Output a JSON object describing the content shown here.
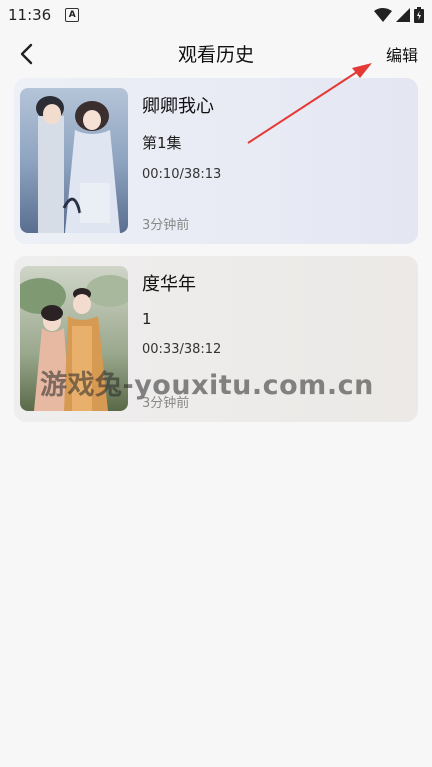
{
  "status_bar": {
    "time": "11:36",
    "badge_letter": "A",
    "icons": [
      "wifi-icon",
      "signal-icon",
      "battery-icon"
    ]
  },
  "header": {
    "title": "观看历史",
    "edit_label": "编辑",
    "back_icon": "chevron-left-icon"
  },
  "history": [
    {
      "title": "卿卿我心",
      "episode": "第1集",
      "progress": "00:10/38:13",
      "time_ago": "3分钟前"
    },
    {
      "title": "度华年",
      "episode": "1",
      "progress": "00:33/38:12",
      "time_ago": "3分钟前"
    }
  ],
  "watermark": "游戏兔-youxitu.com.cn",
  "colors": {
    "accent_arrow": "#e53935",
    "background": "#f7f7f8"
  }
}
